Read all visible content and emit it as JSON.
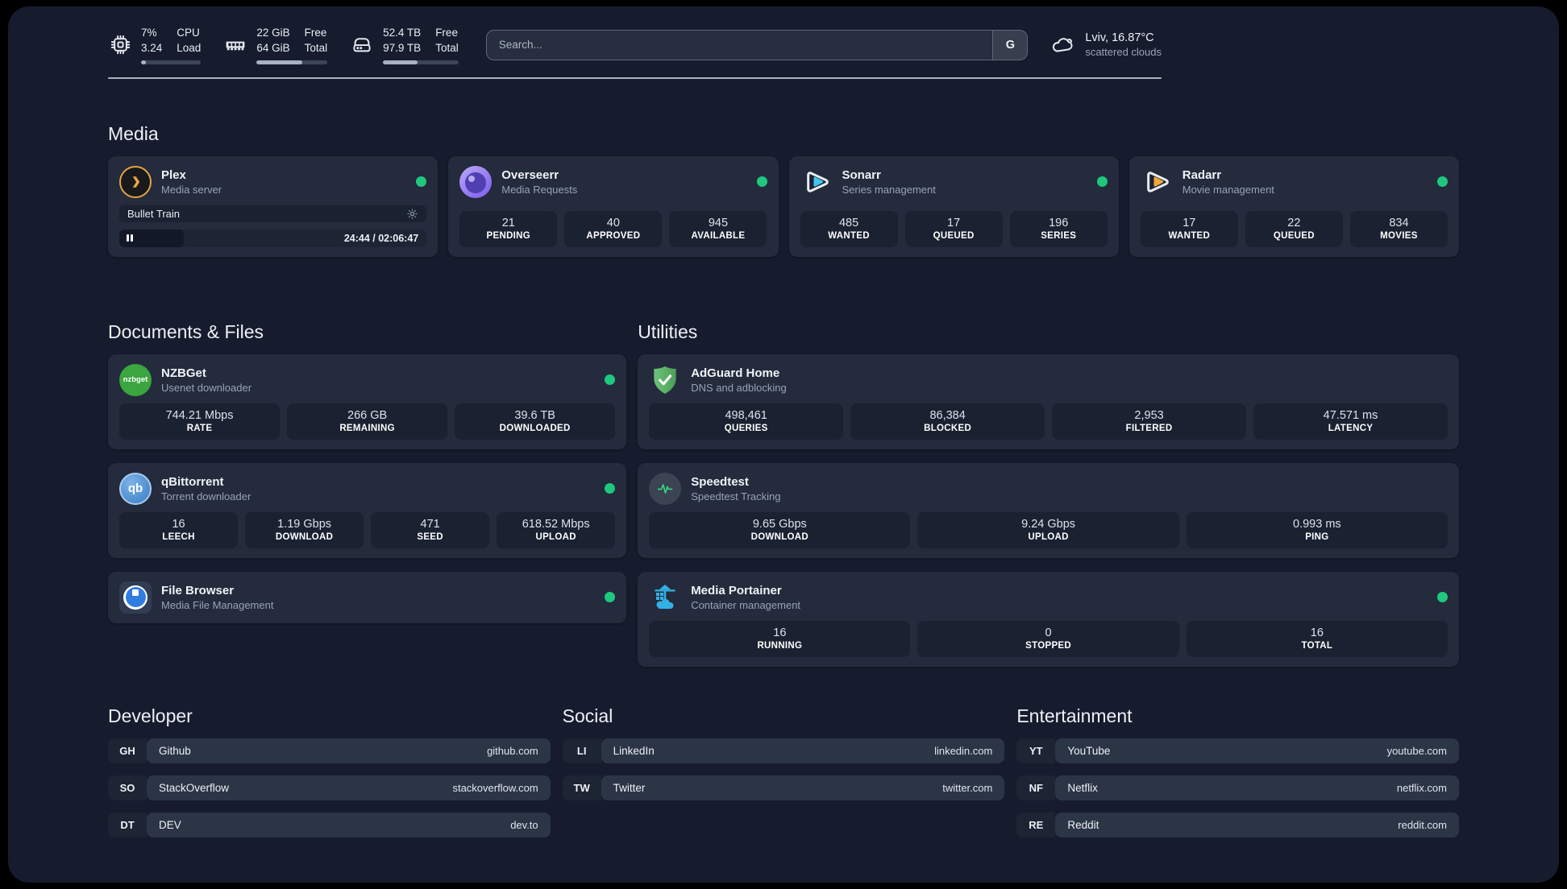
{
  "status_color": "#1fc87e",
  "header": {
    "resources": [
      {
        "id": "cpu",
        "icon": "cpu-icon",
        "values": [
          "7%",
          "3.24"
        ],
        "labels": [
          "CPU",
          "Load"
        ],
        "progress": 8
      },
      {
        "id": "memory",
        "icon": "memory-icon",
        "values": [
          "22 GiB",
          "64 GiB"
        ],
        "labels": [
          "Free",
          "Total"
        ],
        "progress": 64
      },
      {
        "id": "disk",
        "icon": "disk-icon",
        "values": [
          "52.4 TB",
          "97.9 TB"
        ],
        "labels": [
          "Free",
          "Total"
        ],
        "progress": 46
      }
    ],
    "search": {
      "placeholder": "Search...",
      "button_label": "G"
    },
    "weather": {
      "icon": "cloud-icon",
      "location": "Lviv, 16.87°C",
      "condition": "scattered clouds"
    }
  },
  "media": {
    "title": "Media",
    "cards": [
      {
        "id": "plex",
        "icon": "plex-icon",
        "name": "Plex",
        "description": "Media server",
        "status": "online",
        "now_playing": {
          "title": "Bullet Train",
          "state": "paused",
          "elapsed": "24:44",
          "duration": "02:06:47",
          "progress_pct": 19
        }
      },
      {
        "id": "overseerr",
        "icon": "overseerr-icon",
        "name": "Overseerr",
        "description": "Media Requests",
        "status": "online",
        "stats": [
          {
            "value": "21",
            "label": "PENDING"
          },
          {
            "value": "40",
            "label": "APPROVED"
          },
          {
            "value": "945",
            "label": "AVAILABLE"
          }
        ]
      },
      {
        "id": "sonarr",
        "icon": "sonarr-icon",
        "name": "Sonarr",
        "description": "Series management",
        "status": "online",
        "stats": [
          {
            "value": "485",
            "label": "WANTED"
          },
          {
            "value": "17",
            "label": "QUEUED"
          },
          {
            "value": "196",
            "label": "SERIES"
          }
        ]
      },
      {
        "id": "radarr",
        "icon": "radarr-icon",
        "name": "Radarr",
        "description": "Movie management",
        "status": "online",
        "stats": [
          {
            "value": "17",
            "label": "WANTED"
          },
          {
            "value": "22",
            "label": "QUEUED"
          },
          {
            "value": "834",
            "label": "MOVIES"
          }
        ]
      }
    ]
  },
  "documents": {
    "title": "Documents & Files",
    "cards": [
      {
        "id": "nzbget",
        "icon": "nzbget-icon",
        "name": "NZBGet",
        "description": "Usenet downloader",
        "status": "online",
        "stats": [
          {
            "value": "744.21 Mbps",
            "label": "RATE"
          },
          {
            "value": "266 GB",
            "label": "REMAINING"
          },
          {
            "value": "39.6 TB",
            "label": "DOWNLOADED"
          }
        ]
      },
      {
        "id": "qbittorrent",
        "icon": "qbittorrent-icon",
        "name": "qBittorrent",
        "description": "Torrent downloader",
        "status": "online",
        "stats": [
          {
            "value": "16",
            "label": "LEECH"
          },
          {
            "value": "1.19 Gbps",
            "label": "DOWNLOAD"
          },
          {
            "value": "471",
            "label": "SEED"
          },
          {
            "value": "618.52 Mbps",
            "label": "UPLOAD"
          }
        ]
      },
      {
        "id": "filebrowser",
        "icon": "filebrowser-icon",
        "name": "File Browser",
        "description": "Media File Management",
        "status": "online"
      }
    ]
  },
  "utilities": {
    "title": "Utilities",
    "cards": [
      {
        "id": "adguard",
        "icon": "adguard-icon",
        "name": "AdGuard Home",
        "description": "DNS and adblocking",
        "status": null,
        "stats": [
          {
            "value": "498,461",
            "label": "QUERIES"
          },
          {
            "value": "86,384",
            "label": "BLOCKED"
          },
          {
            "value": "2,953",
            "label": "FILTERED"
          },
          {
            "value": "47.571 ms",
            "label": "LATENCY"
          }
        ]
      },
      {
        "id": "speedtest",
        "icon": "speedtest-icon",
        "name": "Speedtest",
        "description": "Speedtest Tracking",
        "status": null,
        "stats": [
          {
            "value": "9.65 Gbps",
            "label": "DOWNLOAD"
          },
          {
            "value": "9.24 Gbps",
            "label": "UPLOAD"
          },
          {
            "value": "0.993 ms",
            "label": "PING"
          }
        ]
      },
      {
        "id": "portainer",
        "icon": "portainer-icon",
        "name": "Media Portainer",
        "description": "Container management",
        "status": "online",
        "stats": [
          {
            "value": "16",
            "label": "RUNNING"
          },
          {
            "value": "0",
            "label": "STOPPED"
          },
          {
            "value": "16",
            "label": "TOTAL"
          }
        ]
      }
    ]
  },
  "bookmarks": [
    {
      "title": "Developer",
      "links": [
        {
          "abbr": "GH",
          "name": "Github",
          "url": "github.com"
        },
        {
          "abbr": "SO",
          "name": "StackOverflow",
          "url": "stackoverflow.com"
        },
        {
          "abbr": "DT",
          "name": "DEV",
          "url": "dev.to"
        }
      ]
    },
    {
      "title": "Social",
      "links": [
        {
          "abbr": "LI",
          "name": "LinkedIn",
          "url": "linkedin.com"
        },
        {
          "abbr": "TW",
          "name": "Twitter",
          "url": "twitter.com"
        }
      ]
    },
    {
      "title": "Entertainment",
      "links": [
        {
          "abbr": "YT",
          "name": "YouTube",
          "url": "youtube.com"
        },
        {
          "abbr": "NF",
          "name": "Netflix",
          "url": "netflix.com"
        },
        {
          "abbr": "RE",
          "name": "Reddit",
          "url": "reddit.com"
        }
      ]
    }
  ]
}
